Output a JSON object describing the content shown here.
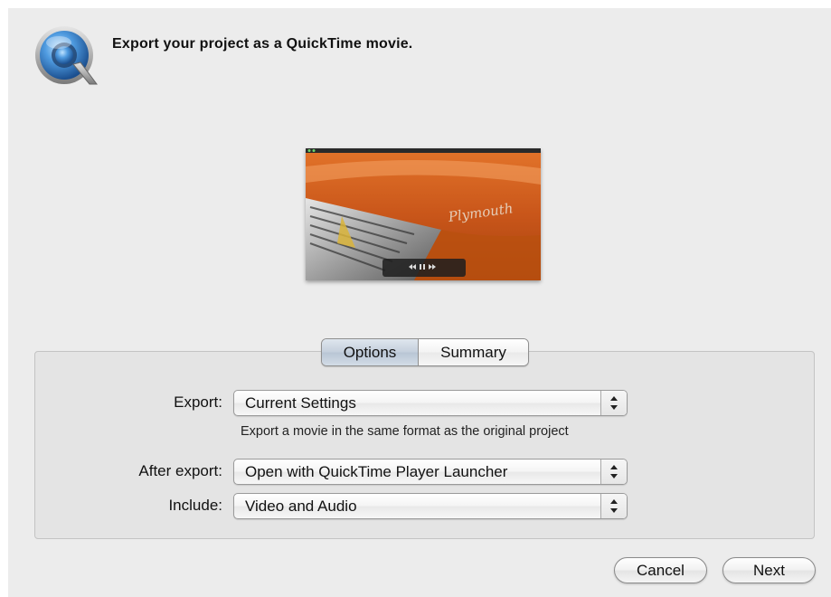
{
  "header": {
    "title": "Export your project as a QuickTime movie.",
    "icon": "quicktime-logo-icon"
  },
  "preview": {
    "badge_text": "Plymouth",
    "controls_icon": "playback-controls-icon"
  },
  "tabs": [
    {
      "label": "Options",
      "selected": true
    },
    {
      "label": "Summary",
      "selected": false
    }
  ],
  "form": {
    "export": {
      "label": "Export:",
      "value": "Current Settings",
      "description": "Export a movie in the same format as the original project"
    },
    "after_export": {
      "label": "After export:",
      "value": "Open with QuickTime Player Launcher"
    },
    "include": {
      "label": "Include:",
      "value": "Video and Audio"
    }
  },
  "buttons": {
    "cancel": "Cancel",
    "next": "Next"
  },
  "colors": {
    "window_bg": "#ececec",
    "group_bg": "#e4e4e4",
    "selected_tab": "#c4cfdc"
  }
}
